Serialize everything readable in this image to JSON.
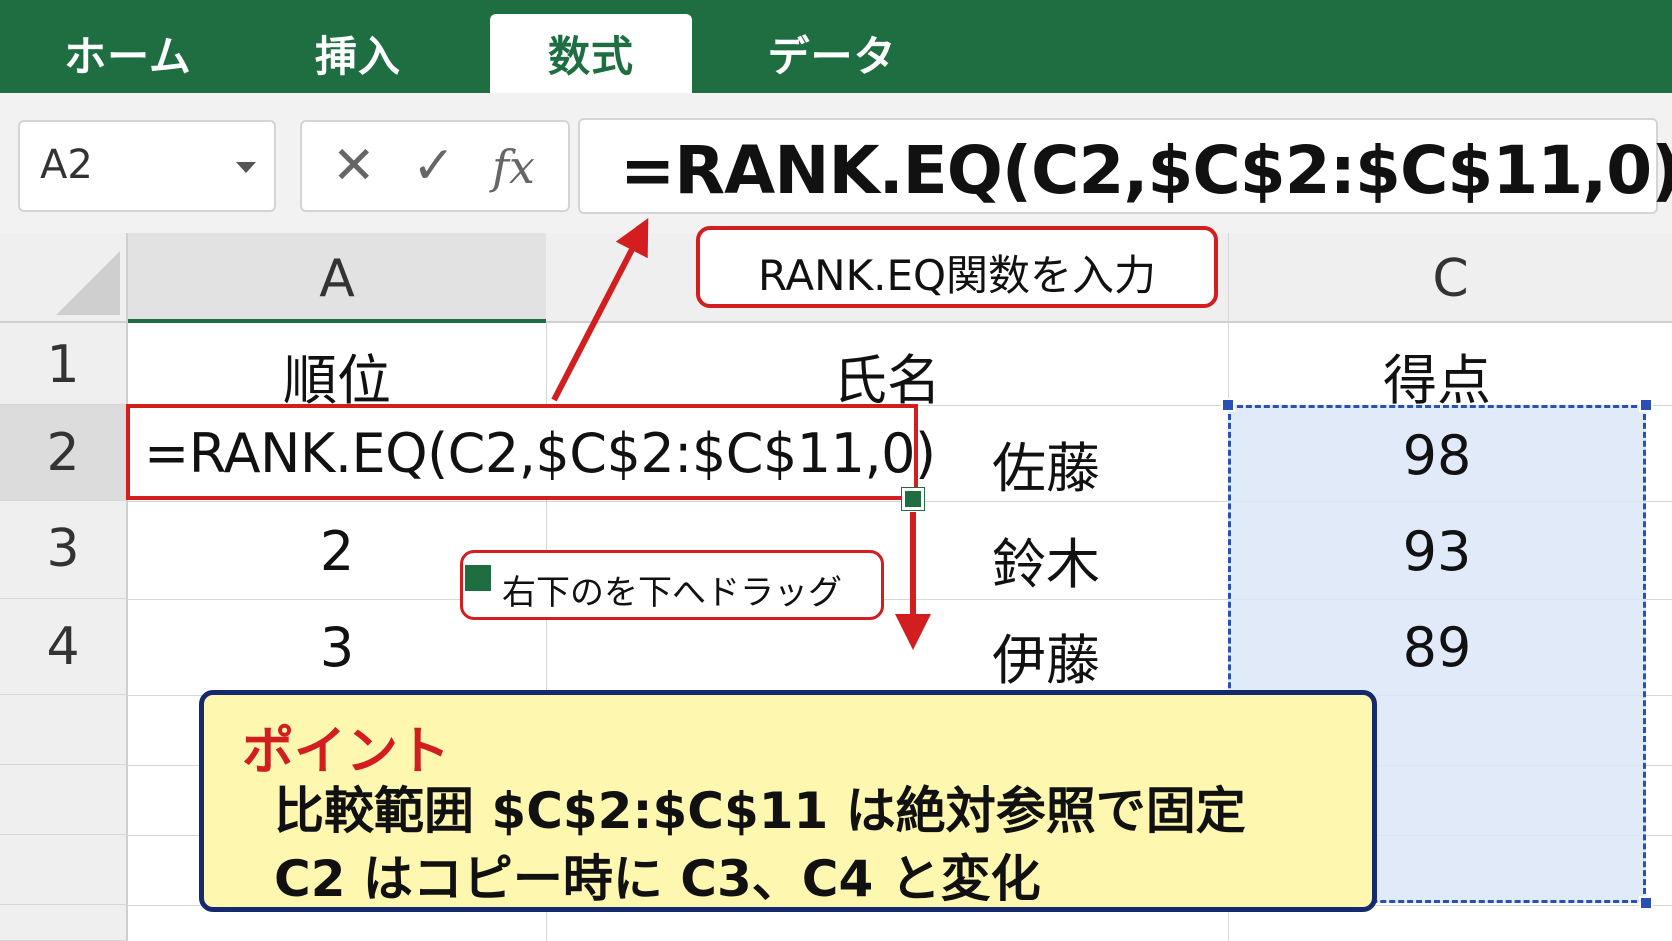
{
  "ribbon": {
    "tabs": [
      {
        "label": "ホーム",
        "active": false
      },
      {
        "label": "挿入",
        "active": false
      },
      {
        "label": "数式",
        "active": true
      },
      {
        "label": "データ",
        "active": false
      }
    ],
    "color": "#1e6e42"
  },
  "formula_bar": {
    "name_box": "A2",
    "cancel_icon": "✕",
    "enter_icon": "✓",
    "fx_label": "fx",
    "formula": "=RANK.EQ(C2,$C$2:$C$11,0)"
  },
  "columns": [
    "A",
    "C"
  ],
  "rows": [
    "1",
    "2",
    "3",
    "4"
  ],
  "cells": {
    "A1": "順位",
    "B1": "氏名",
    "C1": "得点",
    "A2": "=RANK.EQ(C2,$C$2:$C$11,0)",
    "B2": "佐藤",
    "C2": "98",
    "A3": "2",
    "B3": "鈴木",
    "C3": "93",
    "A4": "3",
    "B4": "伊藤",
    "C4": "89"
  },
  "annotations": {
    "input_callout": "RANK.EQ関数を入力",
    "drag_callout_before": "右下の",
    "drag_callout_after": "を下へドラッグ",
    "point_title": "ポイント",
    "point_line1": "比較範囲 $C$2:$C$11 は絶対参照で固定",
    "point_line2": "C2 はコピー時に C3、C4 と変化"
  },
  "colors": {
    "accent_red": "#d21e1e",
    "selection_blue": "#2a4fb5",
    "point_bg": "#fdf7b0",
    "point_border": "#152a6e"
  }
}
